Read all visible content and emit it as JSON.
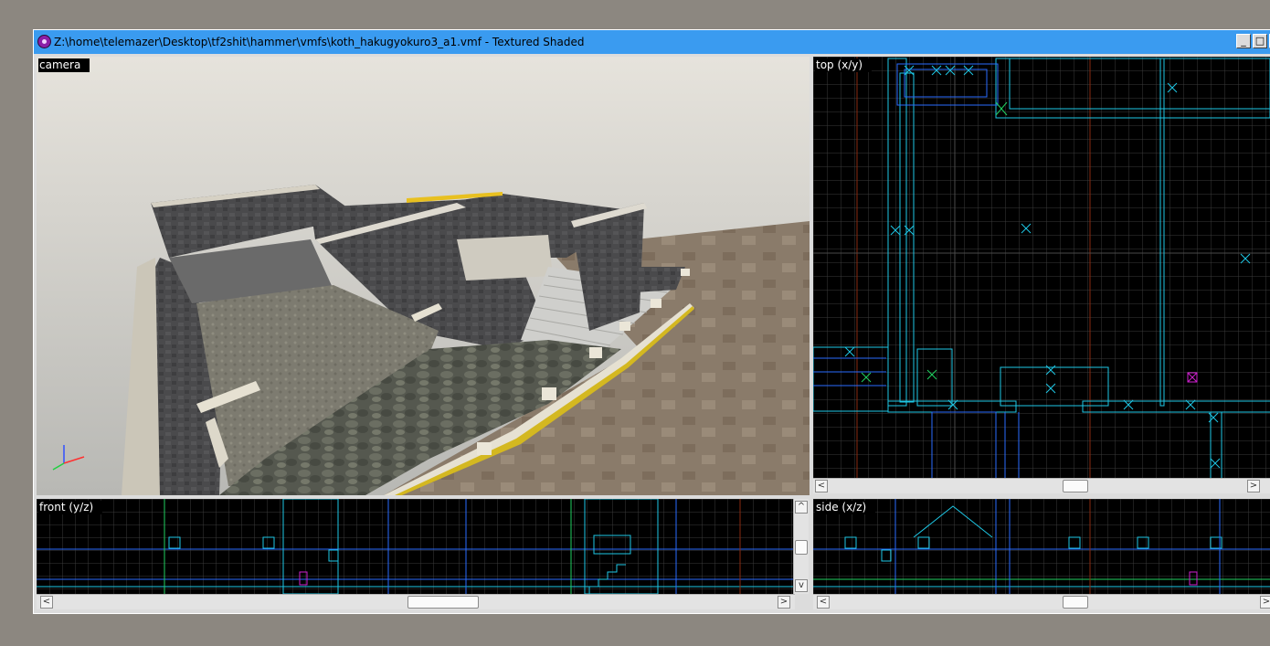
{
  "window": {
    "title": "Z:\\home\\telemazer\\Desktop\\tf2shit\\hammer\\vmfs\\koth_hakugyokuro3_a1.vmf - Textured Shaded",
    "icon": "hammer-app-icon",
    "controls": {
      "minimize": "_",
      "maximize": "□",
      "close": "×"
    }
  },
  "viewports": {
    "camera": {
      "label": "camera"
    },
    "top": {
      "label": "top (x/y)"
    },
    "front": {
      "label": "front (y/z)"
    },
    "side": {
      "label": "side (x/z)"
    }
  },
  "scroll_glyphs": {
    "left": "<",
    "right": ">",
    "up": "^",
    "down": "v"
  },
  "colors": {
    "grid": "#3a3a3a",
    "brush_cyan": "#1ec8e6",
    "brush_blue": "#2a6cff",
    "brush_green": "#20d060",
    "selection_magenta": "#d020d0",
    "axis_red": "#8a2a10",
    "title_bar": "#3a9bf0"
  }
}
